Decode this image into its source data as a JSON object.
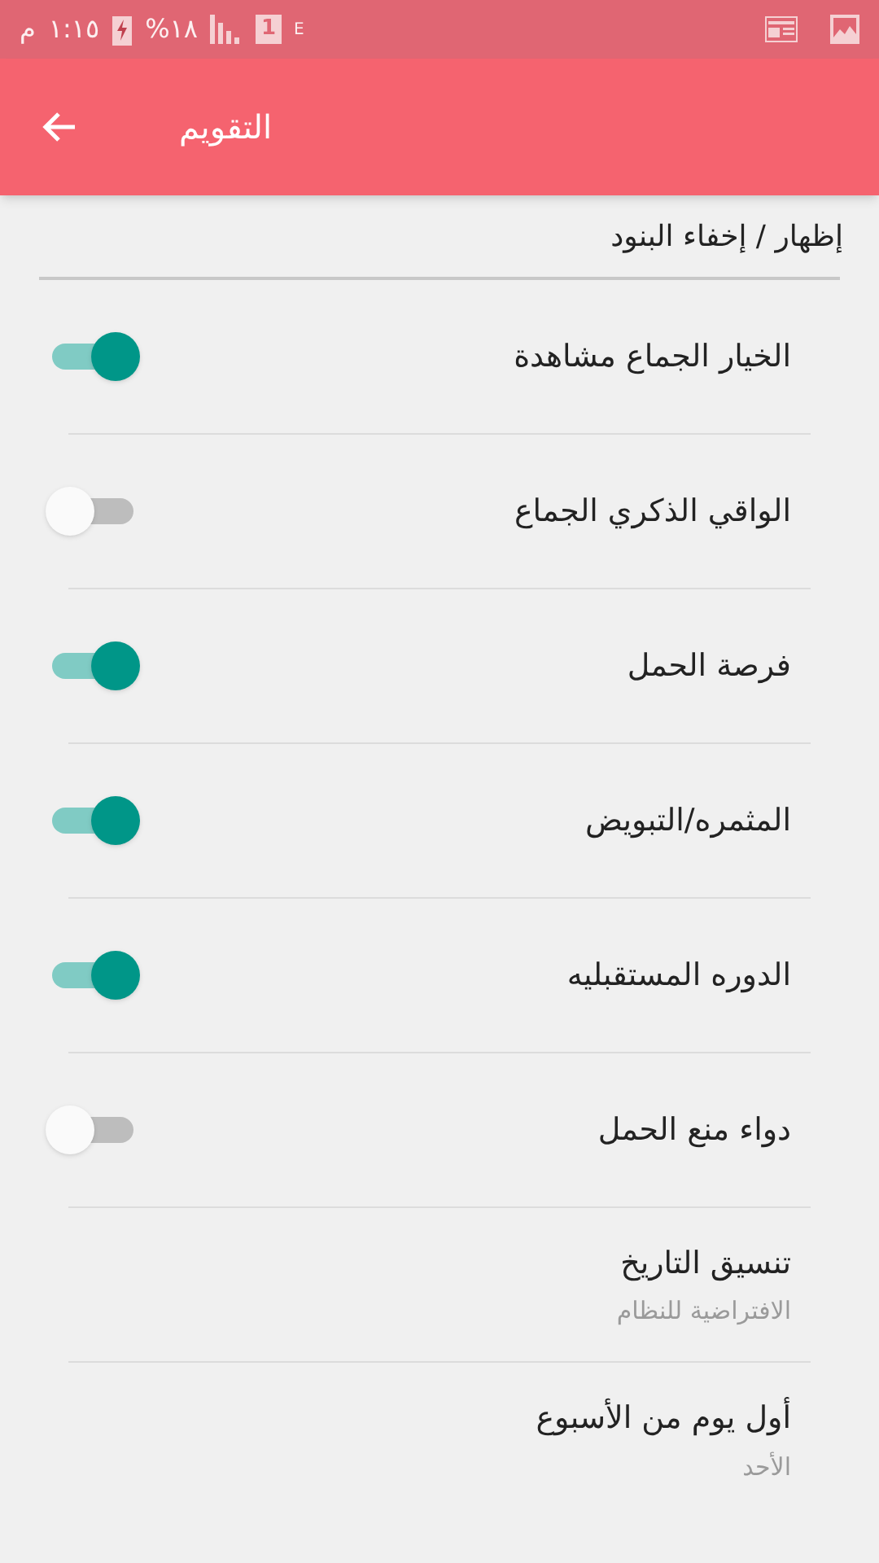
{
  "status_bar": {
    "ampm": "م",
    "time": "١:١٥",
    "battery": "%١٨",
    "sim": "1",
    "network": "E"
  },
  "app_bar": {
    "title": "التقويم"
  },
  "section": {
    "title": "إظهار / إخفاء البنود"
  },
  "items": [
    {
      "kind": "switch",
      "label": "الخيار الجماع مشاهدة",
      "on": true
    },
    {
      "kind": "switch",
      "label": "الواقي الذكري الجماع",
      "on": false
    },
    {
      "kind": "switch",
      "label": "فرصة الحمل",
      "on": true
    },
    {
      "kind": "switch",
      "label": "المثمره/التبويض",
      "on": true
    },
    {
      "kind": "switch",
      "label": "الدوره المستقبليه",
      "on": true
    },
    {
      "kind": "switch",
      "label": "دواء منع الحمل",
      "on": false
    },
    {
      "kind": "setting",
      "label": "تنسيق التاريخ",
      "summary": "الافتراضية للنظام"
    },
    {
      "kind": "setting",
      "label": "أول يوم من الأسبوع",
      "summary": "الأحد"
    }
  ]
}
